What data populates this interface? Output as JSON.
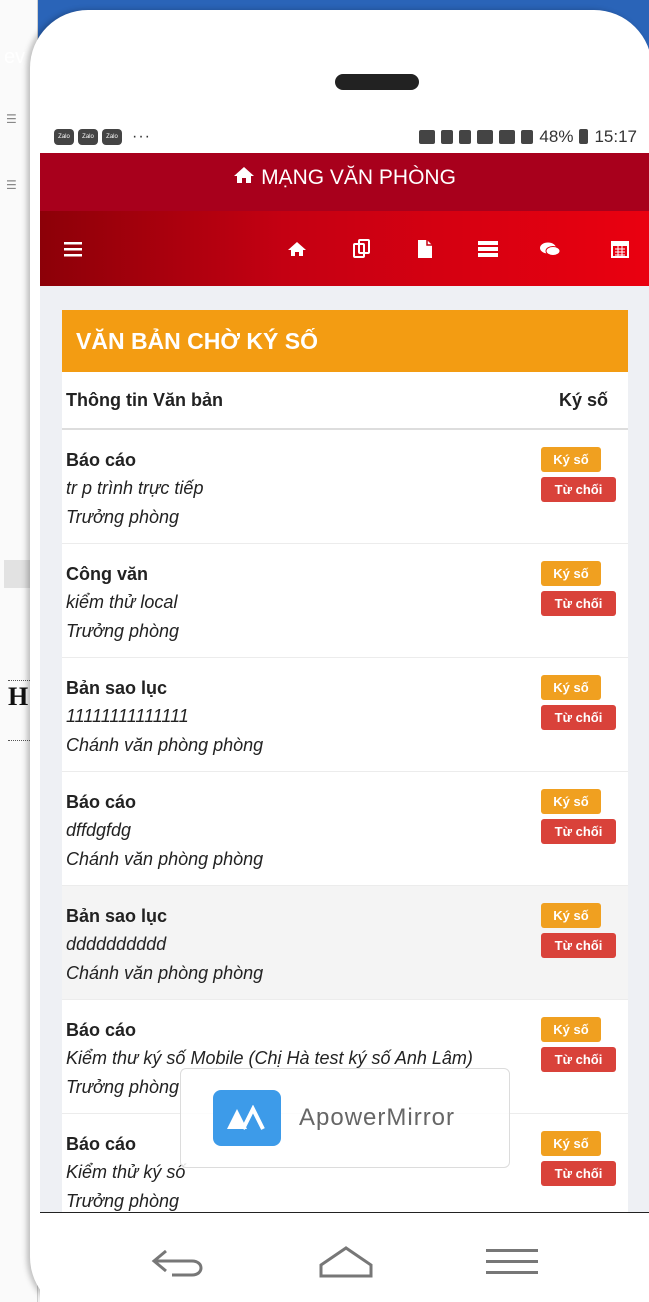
{
  "desktop": {
    "tab_fragment": "ev",
    "heading_fragment": "H"
  },
  "status_bar": {
    "notification_icons": [
      "Zalo",
      "Zalo",
      "Zalo"
    ],
    "more": "···",
    "battery": "48%",
    "time": "15:17"
  },
  "app": {
    "title": "MẠNG VĂN PHÒNG",
    "nav_icons": [
      "menu-icon",
      "home-icon",
      "documents-icon",
      "file-icon",
      "list-icon",
      "chat-icon",
      "calendar-icon"
    ]
  },
  "panel": {
    "title": "VĂN BẢN CHỜ KÝ SỐ",
    "col_info": "Thông tin Văn bản",
    "col_sign": "Ký số"
  },
  "documents": [
    {
      "type": "Báo cáo",
      "title": "tr p trình trực tiếp",
      "role": "Trưởng phòng",
      "sign": "Ký số",
      "reject": "Từ chối"
    },
    {
      "type": "Công văn",
      "title": "kiểm thử local",
      "role": "Trưởng phòng",
      "sign": "Ký số",
      "reject": "Từ chối"
    },
    {
      "type": "Bản sao lục",
      "title": "11111111111111",
      "role": "Chánh văn phòng phòng",
      "sign": "Ký số",
      "reject": "Từ chối"
    },
    {
      "type": "Báo cáo",
      "title": "dffdgfdg",
      "role": "Chánh văn phòng phòng",
      "sign": "Ký số",
      "reject": "Từ chối"
    },
    {
      "type": "Bản sao lục",
      "title": "dddddddddd",
      "role": "Chánh văn phòng phòng",
      "sign": "Ký số",
      "reject": "Từ chối"
    },
    {
      "type": "Báo cáo",
      "title": "Kiểm thư ký số Mobile (Chị Hà test ký số Anh Lâm)",
      "role": "Trưởng phòng",
      "sign": "Ký số",
      "reject": "Từ chối"
    },
    {
      "type": "Báo cáo",
      "title": "Kiểm thử ký số",
      "role": "Trưởng phòng",
      "sign": "Ký số",
      "reject": "Từ chối"
    }
  ],
  "watermark": {
    "text": "ApowerMirror"
  },
  "colors": {
    "header": "#a8001c",
    "nav_gradient_end": "#ea0010",
    "panel_header": "#f39c12",
    "sign_button": "#f0a020",
    "reject_button": "#d9423a"
  }
}
